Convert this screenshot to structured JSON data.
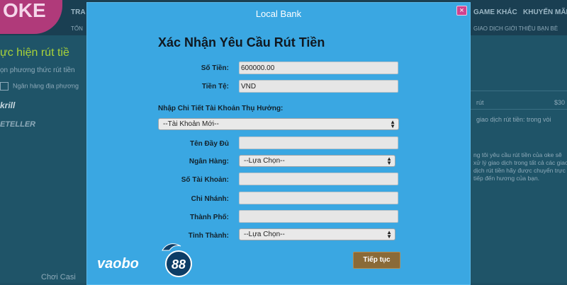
{
  "background": {
    "logo_text": "OKE",
    "nav_top_left": "TRA",
    "nav_top_right_1": "GAME KHÁC",
    "nav_top_right_2": "KHUYẾN MÃI",
    "nav_sub_left": "TỔN",
    "nav_sub_right": "GIAO DỊCH  GIỚI THIỆU BẠN BÈ",
    "heading": "ực hiện rút tiề",
    "subheading": "ọn phương thức rút tiền",
    "bank_row": "Ngân hàng địa phương",
    "skrill": "krill",
    "neteller": "ETELLER",
    "right_label_1": "rút",
    "right_value_1": "$30",
    "right_label_2": "giao dịch rút tiền: trong vòi",
    "right_paragraph": "ng tôi yêu cầu rút tiền của oke sẽ xử lý giao dịch trong tất cả các giao dịch rút tiền hãy được chuyển trực tiếp đến hương của bạn.",
    "bottom_text": "Chơi Casi"
  },
  "modal": {
    "title": "Local Bank",
    "close_label": "×",
    "form_title": "Xác Nhận Yêu Cầu Rút Tiền",
    "amount_label": "Số Tiền:",
    "amount_value": "600000.00",
    "currency_label": "Tiền Tệ:",
    "currency_value": "VND",
    "beneficiary_section_label": "Nhập Chi Tiết Tài Khoản Thụ Hưởng:",
    "account_select_value": "--Tài Khoản Mới--",
    "fullname_label": "Tên Đầy Đủ",
    "fullname_value": "",
    "bank_label": "Ngân Hàng:",
    "bank_select_value": "--Lựa Chọn--",
    "account_number_label": "Số Tài Khoản:",
    "account_number_value": "",
    "branch_label": "Chi Nhánh:",
    "branch_value": "",
    "city_label": "Thành Phố:",
    "city_value": "",
    "province_label": "Tỉnh Thành:",
    "province_select_value": "--Lựa Chọn--",
    "continue_label": "Tiếp tục",
    "brand_text": "vaobo",
    "brand_badge": "88"
  },
  "colors": {
    "modal_bg": "#3aa7e2",
    "close_bg": "#d0428f",
    "continue_bg": "#8a6a38",
    "page_bg": "#1f5468"
  }
}
